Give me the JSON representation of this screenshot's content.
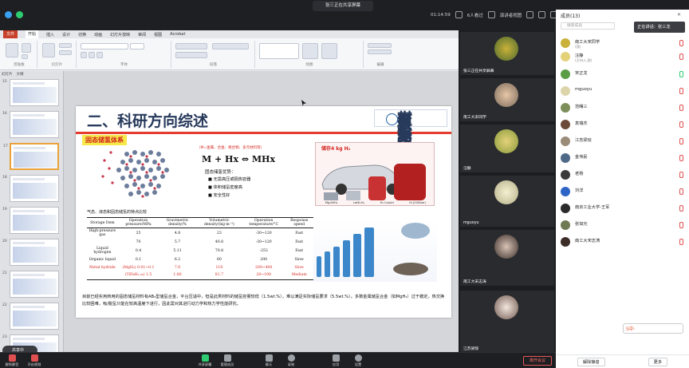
{
  "meeting": {
    "sharer_banner": "张三正在共享屏幕",
    "timer": "01:14:59",
    "participants_count": "6人看过",
    "view_label": "演讲者视图"
  },
  "ppt": {
    "tabs": [
      "文件",
      "开始",
      "插入",
      "设计",
      "切换",
      "动画",
      "幻灯片放映",
      "审阅",
      "视图",
      "Acrobat"
    ],
    "groups": [
      "剪贴板",
      "幻灯片",
      "字体",
      "段落",
      "绘图",
      "编辑"
    ],
    "thumbnail_tabs": [
      "幻灯片",
      "大纲"
    ],
    "thumbnail_numbers": [
      "15",
      "16",
      "17",
      "18",
      "19",
      "20",
      "21",
      "22",
      "23"
    ],
    "selected_slide": "17",
    "floating_pill": "共享中"
  },
  "slide": {
    "title": "二、科研方向综述",
    "logo_line1": "南京工业大学",
    "logo_line2": "材料科学与工程学院",
    "subhead": "固态储氢体系",
    "metal_note": "（M=金属、合金、络合物、多元材料等）",
    "formula": "M + Hx ⇔ MHx",
    "adv_title": "固态储氢优势：",
    "advantages": [
      "无需高压或隔热容器",
      "体积储氢密度高",
      "安全性好"
    ],
    "photo_label": "储存4 kg H₂",
    "tanks": [
      "Mg₂NiH₄",
      "LaNi₅H₆",
      "H₂ Liquid",
      "H₂(200bar)"
    ],
    "table_caption": "气态、液态和固态储氢的特点比较",
    "table_headers": [
      "Storage Item",
      "Operation pressure/MPa",
      "Gravimetric density/%",
      "Volumetric density/(kg·m⁻³)",
      "Operation temperature/°C",
      "Response speed"
    ],
    "table_rows": [
      [
        "High-pressure gas",
        "35",
        "4.8",
        "23",
        "-30~120",
        "Fast"
      ],
      [
        "",
        "70",
        "5.7",
        "40.8",
        "-30~120",
        "Fast"
      ],
      [
        "Liquid hydrogen",
        "0.4",
        "5.11",
        "70.8",
        "-253",
        "Fast"
      ],
      [
        "Organic liquid",
        "0.1",
        "6.2",
        "60",
        "200",
        "Slow"
      ],
      [
        "Metal hydride",
        "(MgH₂) 0.01~0.1",
        "7.6",
        "110",
        "200~400",
        "Slow"
      ],
      [
        "",
        "(TiFeH₁.₉₅) 1.5",
        "1.80",
        "81.7",
        "20~100",
        "Medium"
      ]
    ],
    "bottom_text": "目前已经实用商用的固态储氢材料有AB₅型储氢合金，平台压适中，但是此类材料的储氢容量较低（1.5wt.%），难以满足实际储氢要求（5.5wt.%）。多数金属储氢合金（如MgH₂）过于稳定，热交换比较困难，吸/脱氢只能在较高温度下进行，因此需对其进行动力学和热力学性能研究。"
  },
  "videos": [
    {
      "name": "张三正在共享屏幕"
    },
    {
      "name": "南工大宋同学"
    },
    {
      "name": "汪静"
    },
    {
      "name": "mguoyu"
    },
    {
      "name": "南工大宋志涛"
    },
    {
      "name": "江苏梁琰"
    }
  ],
  "panel": {
    "title": "成员(13)",
    "search_placeholder": "搜索成员",
    "speaking_now": "正在讲话：张三龙",
    "members": [
      {
        "name": "南工大宋同学",
        "sub": "(我)"
      },
      {
        "name": "汪静",
        "sub": "(主持人,我)"
      },
      {
        "name": "宋正龙",
        "sub": ""
      },
      {
        "name": "mguoyu",
        "sub": ""
      },
      {
        "name": "范曙三",
        "sub": ""
      },
      {
        "name": "袁瑞杰",
        "sub": ""
      },
      {
        "name": "江苏梁琰",
        "sub": ""
      },
      {
        "name": "金伟民",
        "sub": ""
      },
      {
        "name": "老杨",
        "sub": ""
      },
      {
        "name": "刘洋",
        "sub": ""
      },
      {
        "name": "南京工业大学-王军",
        "sub": ""
      },
      {
        "name": "张如光",
        "sub": ""
      },
      {
        "name": "南工大宋志涛",
        "sub": ""
      }
    ],
    "footer_buttons": [
      "解除静音",
      "更多"
    ]
  },
  "toolbar": {
    "tools": [
      "解除静音",
      "开启视频",
      "共享屏幕",
      "管理成员",
      "聊天",
      "录制",
      "应用",
      "设置"
    ],
    "leave": "离开会议"
  },
  "ime": "S中·",
  "colors": {
    "accent": "#e63c2f",
    "title_blue": "#273a5c",
    "leave_red": "#e45757"
  }
}
